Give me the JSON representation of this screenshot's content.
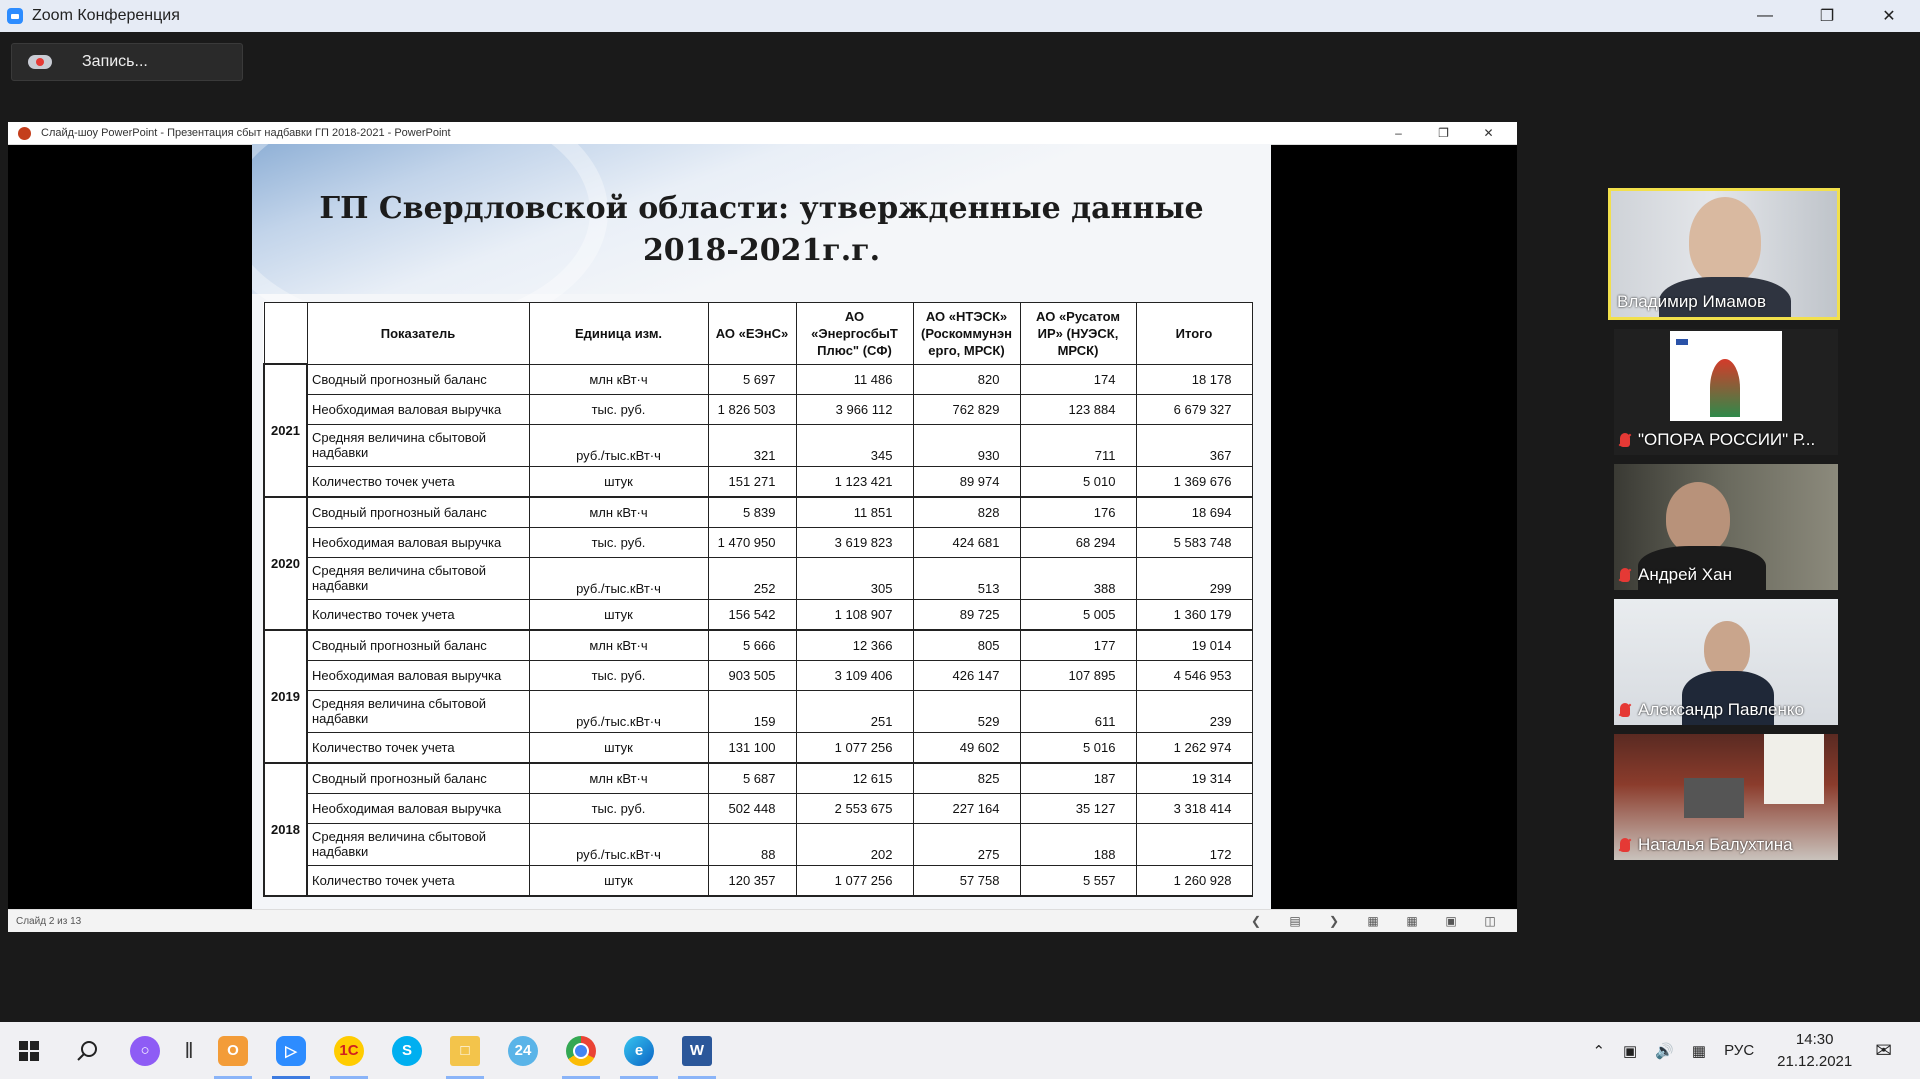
{
  "zoom": {
    "title": "Zoom Конференция",
    "record_label": "Запись..."
  },
  "ppt": {
    "window_title": "Слайд-шоу PowerPoint  -  Презентация сбыт надбавки ГП 2018-2021  -  PowerPoint",
    "slide_status": "Слайд 2 из 13"
  },
  "slide": {
    "title_line1": "ГП Свердловской области: утвержденные данные",
    "title_line2": "2018-2021г.г."
  },
  "table": {
    "headers": [
      "Показатель",
      "Единица изм.",
      "АО «ЕЭнС»",
      "АО «ЭнергосбыТ Плюс\" (СФ)",
      "АО «НТЭСК» (Роскоммунэн ерго, МРСК)",
      "АО «Русатом ИР» (НУЭСК, МРСК)",
      "Итого"
    ],
    "groups": [
      {
        "year": "2021",
        "rows": [
          {
            "name": "Сводный прогнозный баланс",
            "unit": "млн кВт·ч",
            "v": [
              "5 697",
              "11 486",
              "820",
              "174",
              "18 178"
            ]
          },
          {
            "name": "Необходимая валовая выручка",
            "unit": "тыс. руб.",
            "v": [
              "1 826 503",
              "3 966 112",
              "762 829",
              "123 884",
              "6 679 327"
            ]
          },
          {
            "name": "Средняя величина сбытовой надбавки",
            "unit": "руб./тыс.кВт·ч",
            "v": [
              "321",
              "345",
              "930",
              "711",
              "367"
            ]
          },
          {
            "name": "Количество точек учета",
            "unit": "штук",
            "v": [
              "151 271",
              "1 123 421",
              "89 974",
              "5 010",
              "1 369 676"
            ]
          }
        ]
      },
      {
        "year": "2020",
        "rows": [
          {
            "name": "Сводный прогнозный баланс",
            "unit": "млн кВт·ч",
            "v": [
              "5 839",
              "11 851",
              "828",
              "176",
              "18 694"
            ]
          },
          {
            "name": "Необходимая валовая выручка",
            "unit": "тыс. руб.",
            "v": [
              "1 470 950",
              "3 619 823",
              "424 681",
              "68 294",
              "5 583 748"
            ]
          },
          {
            "name": "Средняя величина сбытовой надбавки",
            "unit": "руб./тыс.кВт·ч",
            "v": [
              "252",
              "305",
              "513",
              "388",
              "299"
            ]
          },
          {
            "name": "Количество точек учета",
            "unit": "штук",
            "v": [
              "156 542",
              "1 108 907",
              "89 725",
              "5 005",
              "1 360 179"
            ]
          }
        ]
      },
      {
        "year": "2019",
        "rows": [
          {
            "name": "Сводный прогнозный баланс",
            "unit": "млн кВт·ч",
            "v": [
              "5 666",
              "12 366",
              "805",
              "177",
              "19 014"
            ]
          },
          {
            "name": "Необходимая валовая выручка",
            "unit": "тыс. руб.",
            "v": [
              "903 505",
              "3 109 406",
              "426 147",
              "107 895",
              "4 546 953"
            ]
          },
          {
            "name": "Средняя величина сбытовой надбавки",
            "unit": "руб./тыс.кВт·ч",
            "v": [
              "159",
              "251",
              "529",
              "611",
              "239"
            ]
          },
          {
            "name": "Количество точек учета",
            "unit": "штук",
            "v": [
              "131 100",
              "1 077 256",
              "49 602",
              "5 016",
              "1 262 974"
            ]
          }
        ]
      },
      {
        "year": "2018",
        "rows": [
          {
            "name": "Сводный прогнозный баланс",
            "unit": "млн кВт·ч",
            "v": [
              "5 687",
              "12 615",
              "825",
              "187",
              "19 314"
            ]
          },
          {
            "name": "Необходимая валовая выручка",
            "unit": "тыс. руб.",
            "v": [
              "502 448",
              "2 553 675",
              "227 164",
              "35 127",
              "3 318 414"
            ]
          },
          {
            "name": "Средняя величина сбытовой надбавки",
            "unit": "руб./тыс.кВт·ч",
            "v": [
              "88",
              "202",
              "275",
              "188",
              "172"
            ]
          },
          {
            "name": "Количество точек учета",
            "unit": "штук",
            "v": [
              "120 357",
              "1 077 256",
              "57 758",
              "5 557",
              "1 260 928"
            ]
          }
        ]
      }
    ]
  },
  "participants": [
    {
      "name": "Владимир Имамов",
      "muted": false,
      "active": true
    },
    {
      "name": "\"ОПОРА РОССИИ\" Р...",
      "muted": true,
      "active": false
    },
    {
      "name": "Андрей Хан",
      "muted": true,
      "active": false
    },
    {
      "name": "Александр Павленко",
      "muted": true,
      "active": false
    },
    {
      "name": "Наталья Балухтина",
      "muted": true,
      "active": false
    }
  ],
  "taskbar": {
    "language": "РУС",
    "time": "14:30",
    "date": "21.12.2021",
    "apps": [
      "start-icon",
      "search-icon",
      "alice-icon",
      "separator-icon",
      "outlook-icon",
      "zoom-icon",
      "1c-icon",
      "skype-icon",
      "file-explorer-icon",
      "24-icon",
      "chrome-icon",
      "edge-icon",
      "word-icon"
    ]
  },
  "colors": {
    "active_speaker_border": "#f2e04c",
    "muted_red": "#e53935",
    "zoom_blue": "#2d8cff"
  }
}
